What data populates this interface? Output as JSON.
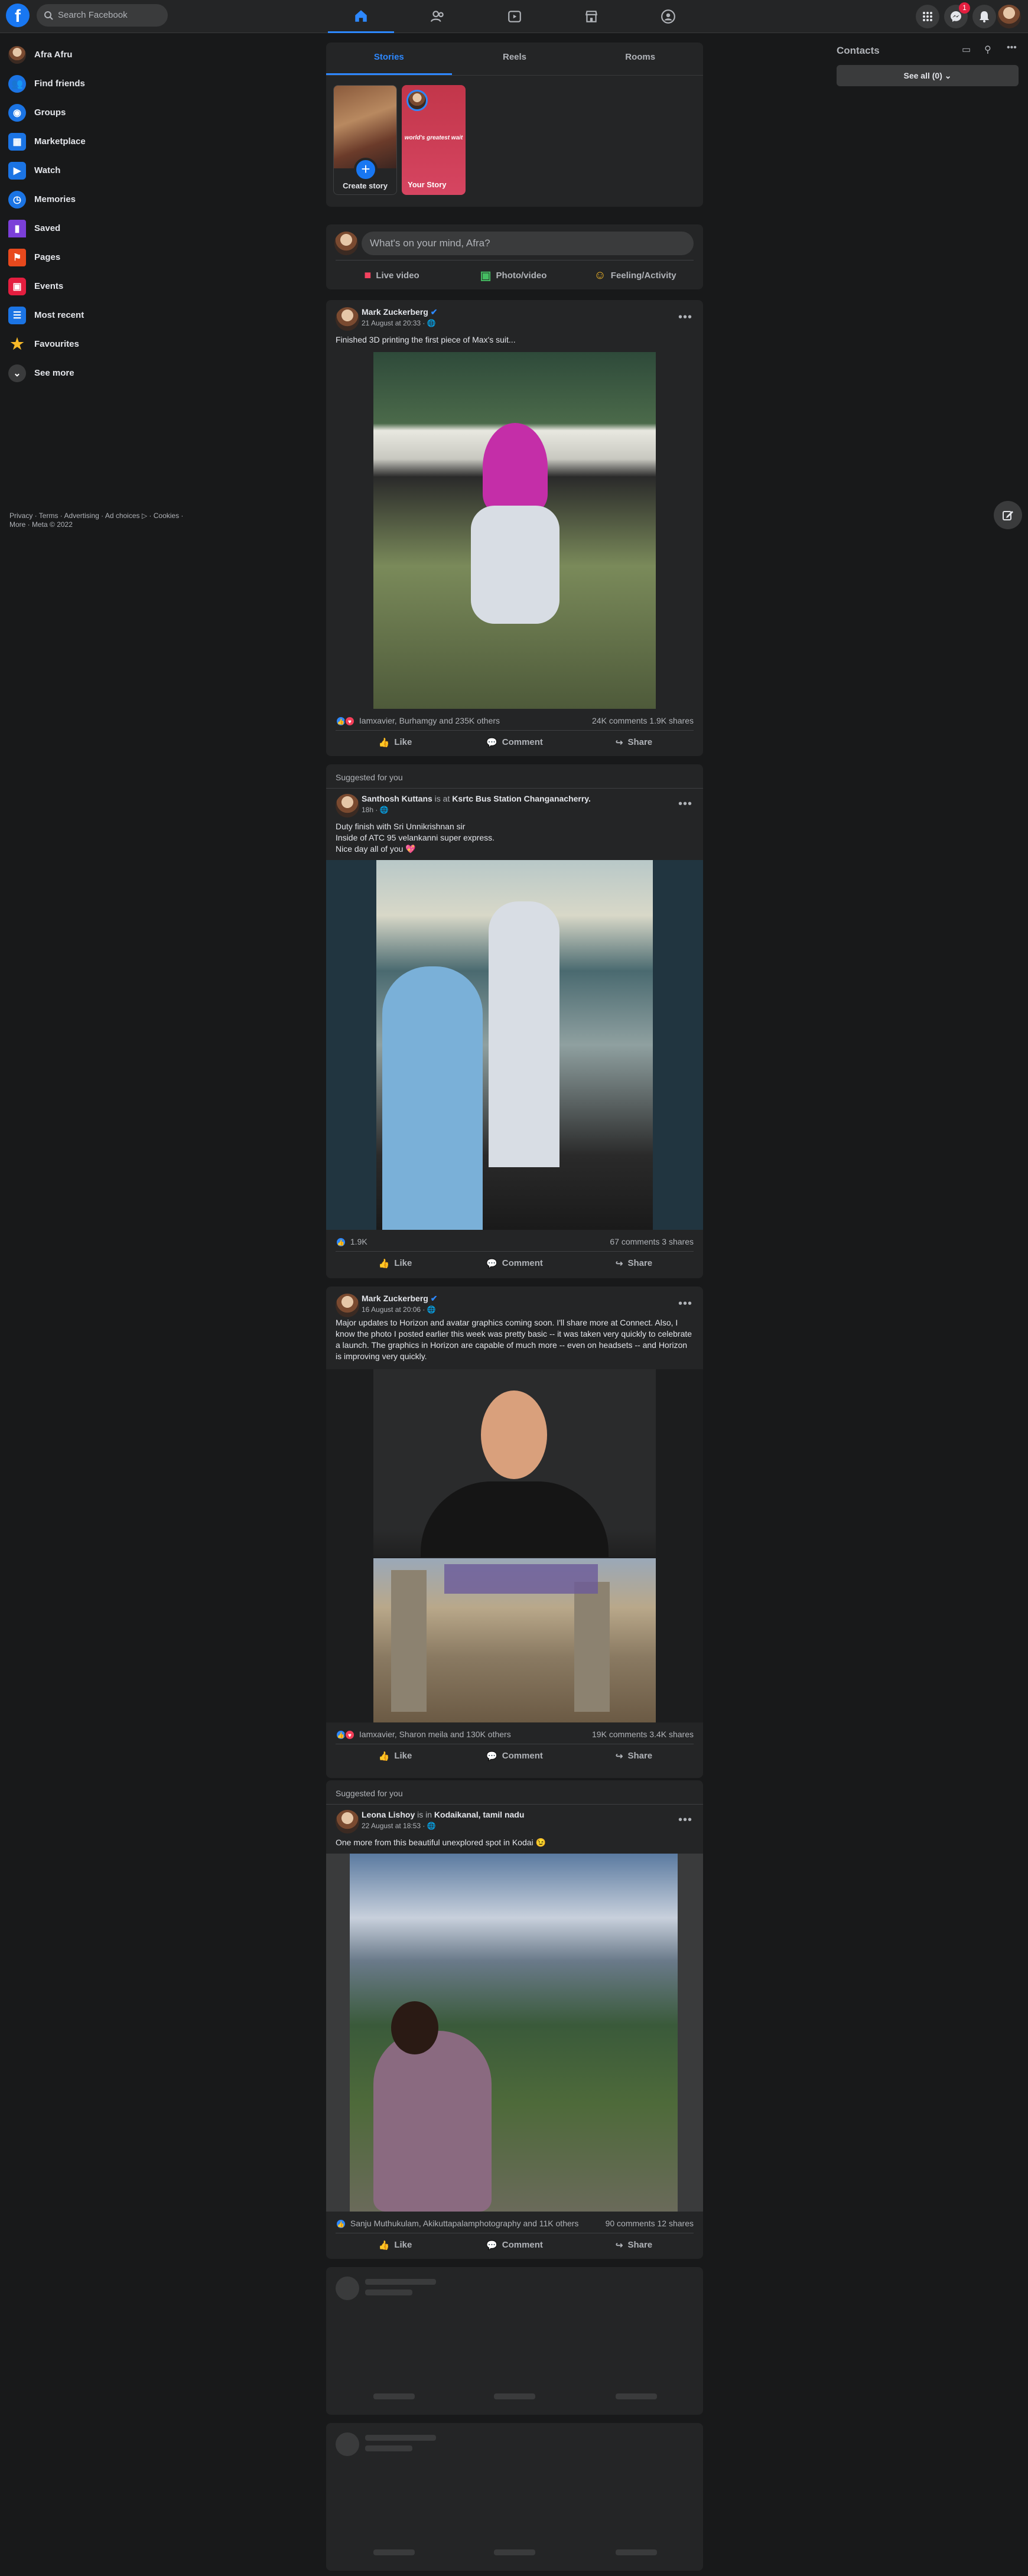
{
  "header": {
    "logo": "f",
    "search_placeholder": "Search Facebook",
    "notification_count": "1",
    "nav_tabs": [
      "home",
      "friends",
      "watch",
      "marketplace",
      "groups"
    ]
  },
  "sidebar": {
    "items": [
      {
        "label": "Afra Afru",
        "icon": "avatar"
      },
      {
        "label": "Find friends",
        "icon": "friends-icon"
      },
      {
        "label": "Groups",
        "icon": "groups-icon"
      },
      {
        "label": "Marketplace",
        "icon": "marketplace-icon"
      },
      {
        "label": "Watch",
        "icon": "watch-icon"
      },
      {
        "label": "Memories",
        "icon": "memories-icon"
      },
      {
        "label": "Saved",
        "icon": "saved-icon"
      },
      {
        "label": "Pages",
        "icon": "pages-icon"
      },
      {
        "label": "Events",
        "icon": "events-icon"
      },
      {
        "label": "Most recent",
        "icon": "most-recent-icon"
      },
      {
        "label": "Favourites",
        "icon": "favourites-icon"
      },
      {
        "label": "See more",
        "icon": "chevron-down-icon"
      }
    ],
    "legal_line1": "Privacy · Terms · Advertising · Ad choices ▷ · Cookies ·",
    "legal_line2": "More · Meta © 2022"
  },
  "stories": {
    "tabs": [
      "Stories",
      "Reels",
      "Rooms"
    ],
    "create_label": "Create story",
    "your_story_label": "Your Story",
    "your_story_text": "world's greatest wait"
  },
  "composer": {
    "placeholder": "What's on your mind, Afra?",
    "live_label": "Live video",
    "photo_label": "Photo/video",
    "feeling_label": "Feeling/Activity"
  },
  "posts": [
    {
      "author": "Mark Zuckerberg",
      "time": "21 August at 20:33 · ",
      "text": "Finished 3D printing the first piece of Max's suit...",
      "reactions": "Iamxavier, Burhamgy and 235K others",
      "counts": "24K comments  1.9K shares"
    },
    {
      "suggested": "Suggested for you",
      "author": "Santhosh Kuttans",
      "at_label": " is at ",
      "place": "Ksrtc Bus Station Changanacherry.",
      "time": "18h · ",
      "text1": "Duty finish with Sri Unnikrishnan sir",
      "text2": "Inside of ATC 95 velankanni super express.",
      "text3": "Nice day all of you 💖",
      "reactions": "1.9K",
      "counts": "67 comments  3 shares"
    },
    {
      "author": "Mark Zuckerberg",
      "time": "16 August at 20:06 · ",
      "text": "Major updates to Horizon and avatar graphics coming soon. I'll share more at Connect. Also, I know the photo I posted earlier this week was pretty basic -- it was taken very quickly to celebrate a launch. The graphics in Horizon are capable of much more -- even on headsets -- and Horizon is improving very quickly.",
      "reactions": "Iamxavier, Sharon meila and 130K others",
      "counts": "19K comments  3.4K shares"
    },
    {
      "suggested": "Suggested for you",
      "author": "Leona Lishoy",
      "at_label": " is in ",
      "place": "Kodaikanal, tamil nadu",
      "time": "22 August at 18:53 · ",
      "text": "One more from this beautiful unexplored spot in Kodai 😉",
      "reactions": "Sanju Muthukulam, Akikuttapalamphotography and 11K others",
      "counts": "90 comments  12 shares"
    }
  ],
  "post_actions": {
    "like": "Like",
    "comment": "Comment",
    "share": "Share"
  },
  "contacts": {
    "title": "Contacts",
    "see_all": "See all (0)"
  },
  "colors": {
    "accent": "#2d88ff",
    "brand": "#1877f2",
    "bg": "#18191a",
    "card": "#242526"
  }
}
